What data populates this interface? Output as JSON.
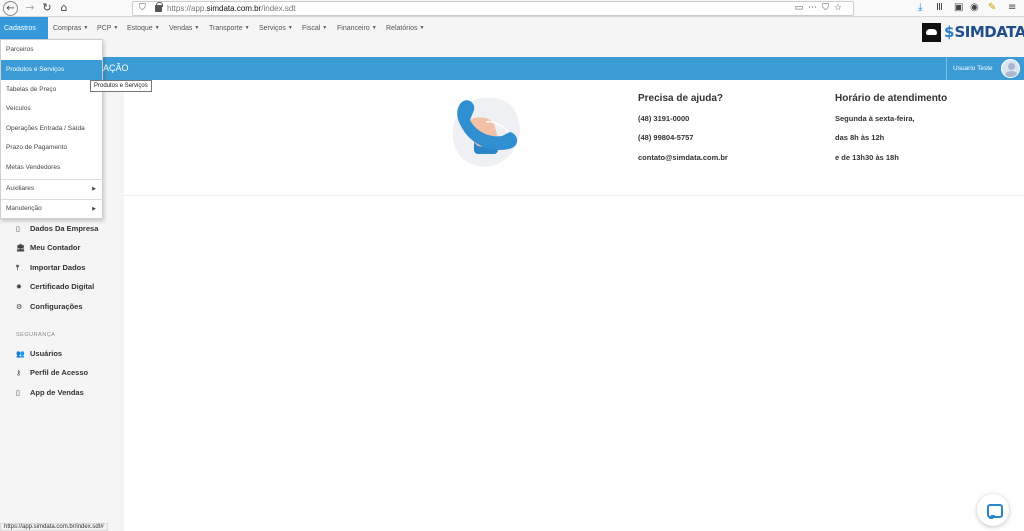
{
  "browser": {
    "url": "https://app.simdata.com.br/index.sdt",
    "url_prefix": "https://app.",
    "url_domain": "simdata.com.br",
    "url_path": "/index.sdt",
    "status_url": "https://app.simdata.com.br/index.sdt#"
  },
  "menu": {
    "items": [
      {
        "label": "Cadastros",
        "caret": false
      },
      {
        "label": "Compras",
        "caret": true
      },
      {
        "label": "PCP",
        "caret": true
      },
      {
        "label": "Estoque",
        "caret": true
      },
      {
        "label": "Vendas",
        "caret": true
      },
      {
        "label": "Transporte",
        "caret": true
      },
      {
        "label": "Serviços",
        "caret": true
      },
      {
        "label": "Fiscal",
        "caret": true
      },
      {
        "label": "Financeiro",
        "caret": true
      },
      {
        "label": "Relatórios",
        "caret": true
      }
    ],
    "caret_glyph": "▼"
  },
  "logo": {
    "text": "SIMDATA",
    "s_glyph": "$"
  },
  "title_bar": {
    "title": "AÇÃO",
    "user_name": "Usuario Teste"
  },
  "dropdown": {
    "items": [
      "Parceiros",
      "Produtos e Serviços",
      "Tabelas de Preço",
      "Veículos",
      "Operações Entrada / Saída",
      "Prazo de Pagamento",
      "Metas Vendedores"
    ],
    "submenus": [
      "Auxiliares",
      "Manutenção"
    ],
    "arrow_glyph": "▶"
  },
  "tooltip": "Produtos e Serviços",
  "sidebar": {
    "items": [
      {
        "label": "Dados Da Empresa",
        "icon": "building-icon",
        "glyph": "▯"
      },
      {
        "label": "Meu Contador",
        "icon": "bank-icon",
        "glyph": "🏛"
      },
      {
        "label": "Importar Dados",
        "icon": "upload-icon",
        "glyph": "⤒"
      },
      {
        "label": "Certificado Digital",
        "icon": "certificate-icon",
        "glyph": "✹"
      },
      {
        "label": "Configurações",
        "icon": "gears-icon",
        "glyph": "⚙"
      }
    ],
    "section_label": "SEGURANÇA",
    "security_items": [
      {
        "label": "Usuários",
        "icon": "users-icon",
        "glyph": "👥"
      },
      {
        "label": "Perfil de Acesso",
        "icon": "key-icon",
        "glyph": "⚷"
      },
      {
        "label": "App de Vendas",
        "icon": "mobile-icon",
        "glyph": "▯"
      }
    ]
  },
  "help": {
    "title": "Precisa de ajuda?",
    "phone1": "(48) 3191-0000",
    "phone2": "(48) 99804-5757",
    "email": "contato@simdata.com.br"
  },
  "hours": {
    "title": "Horário de atendimento",
    "line1": "Segunda à sexta-feira,",
    "line2": "das 8h às 12h",
    "line3": "e de 13h30 às 18h"
  },
  "colors": {
    "accent": "#3a9bd5",
    "menu_active": "#3498db",
    "sidebar_bg": "#f5f5f5"
  }
}
